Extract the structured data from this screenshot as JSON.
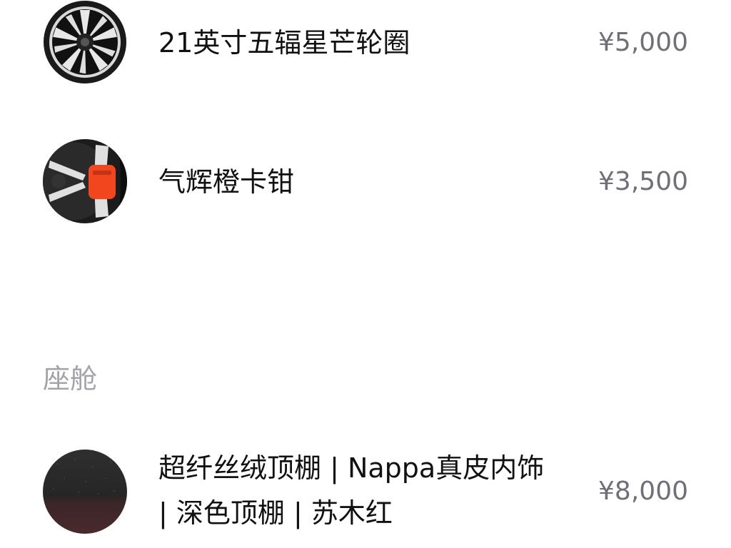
{
  "options": [
    {
      "name": "21英寸五辐星芒轮圈",
      "price": "¥5,000",
      "thumb_icon": "wheel-rim-icon"
    },
    {
      "name": "气辉橙卡钳",
      "price": "¥3,500",
      "thumb_icon": "orange-caliper-icon"
    }
  ],
  "cabin": {
    "section_title": "座舱",
    "item": {
      "name_line1": "超纤丝绒顶棚 | Nappa真皮内饰",
      "name_line2": "| 深色顶棚 | 苏木红",
      "price": "¥8,000",
      "thumb_icon": "interior-fabric-swatch-icon"
    }
  },
  "colors": {
    "name_text": "#111111",
    "price_text": "#6f6f78",
    "section_title": "#a3a3aa",
    "caliper_orange": "#f2461f"
  }
}
